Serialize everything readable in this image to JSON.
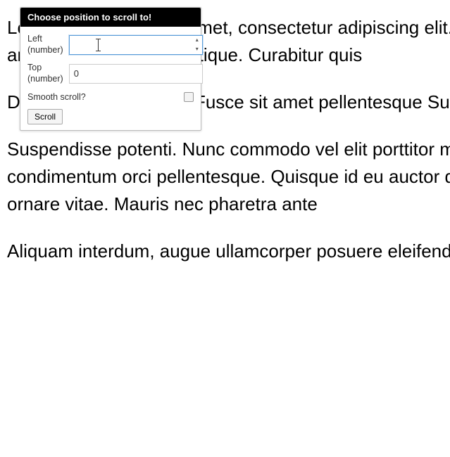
{
  "popup": {
    "title": "Choose position to scroll to!",
    "left_label": "Left (number)",
    "left_value": "",
    "top_label": "Top (number)",
    "top_value": "0",
    "smooth_label": "Smooth scroll?",
    "scroll_button": "Scroll"
  },
  "content": {
    "p1": "Lorem ipsum dolor sit amet, consectetur adipiscing elit. Duis placerat quis est tortor, consequat sit amet dignissim sem tristique. Curabitur quis",
    "p2": "Duis dapibus posuero. Fusce sit amet pellentesque Suspendisse viverra sit amet nulla sit amet",
    "p3": "Suspendisse potenti. Nunc commodo vel elit porttitor mauris convallis. Nulla sit amet cursus condimentum orci pellentesque. Quisque id eu auctor dui. Etiam auctor mi in lorem faucibus magna ornare vitae. Mauris nec pharetra ante",
    "p4": "Aliquam interdum, augue ullamcorper posuere eleifend feugiat. Curabitur quis venenatis"
  }
}
